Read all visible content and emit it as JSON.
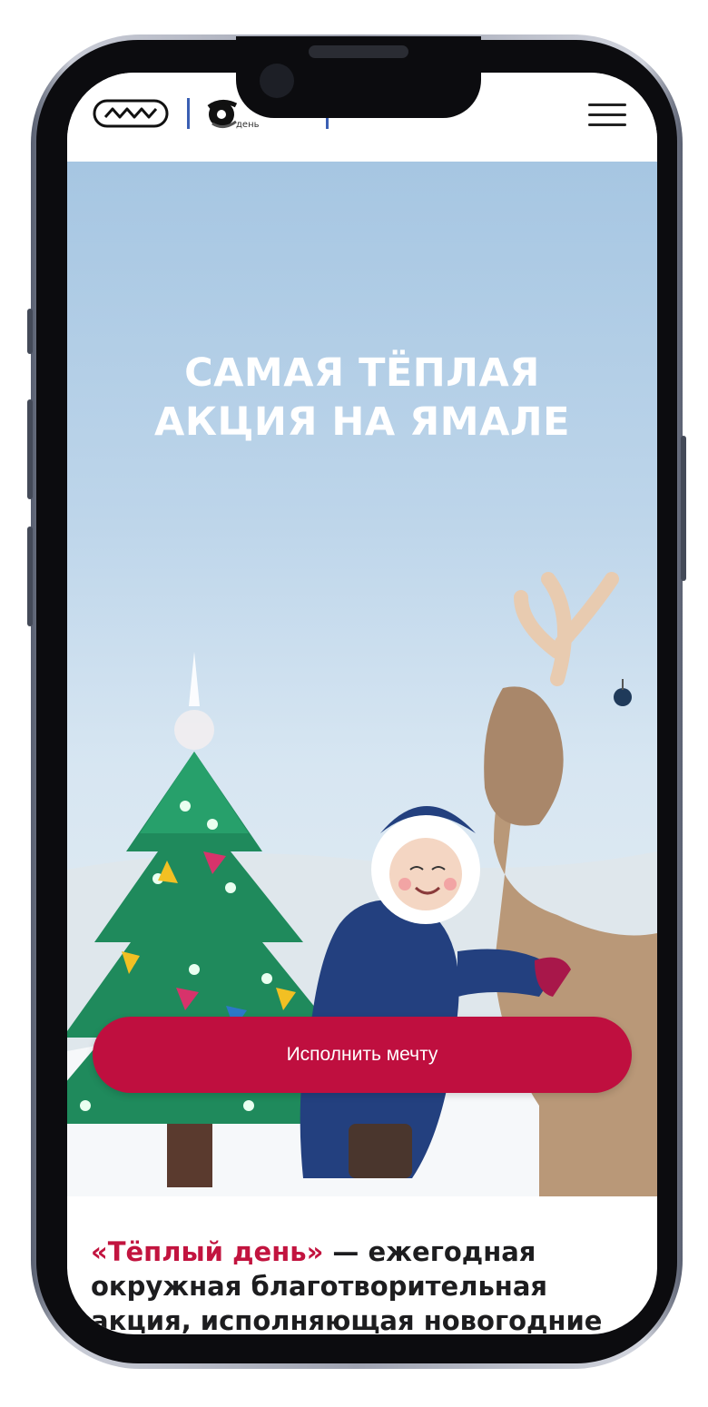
{
  "header": {
    "logo_main": "ЛЛЛ",
    "logo_second_caption": "день",
    "menu_icon": "hamburger-icon"
  },
  "hero": {
    "title_line1": "САМАЯ ТЁПЛАЯ",
    "title_line2": "АКЦИЯ НА ЯМАЛЕ",
    "cta_label": "Исполнить мечту"
  },
  "intro": {
    "accent": "«Тёплый день»",
    "line1_rest": " — ежегодная",
    "line2": "окружная благотворительная",
    "line3": "акция, исполняющая новогодние"
  },
  "colors": {
    "accent": "#bf0f3f",
    "sky": "#a6c6e2",
    "tree": "#1f8a5c",
    "coat": "#23407f",
    "reindeer": "#b99878"
  }
}
